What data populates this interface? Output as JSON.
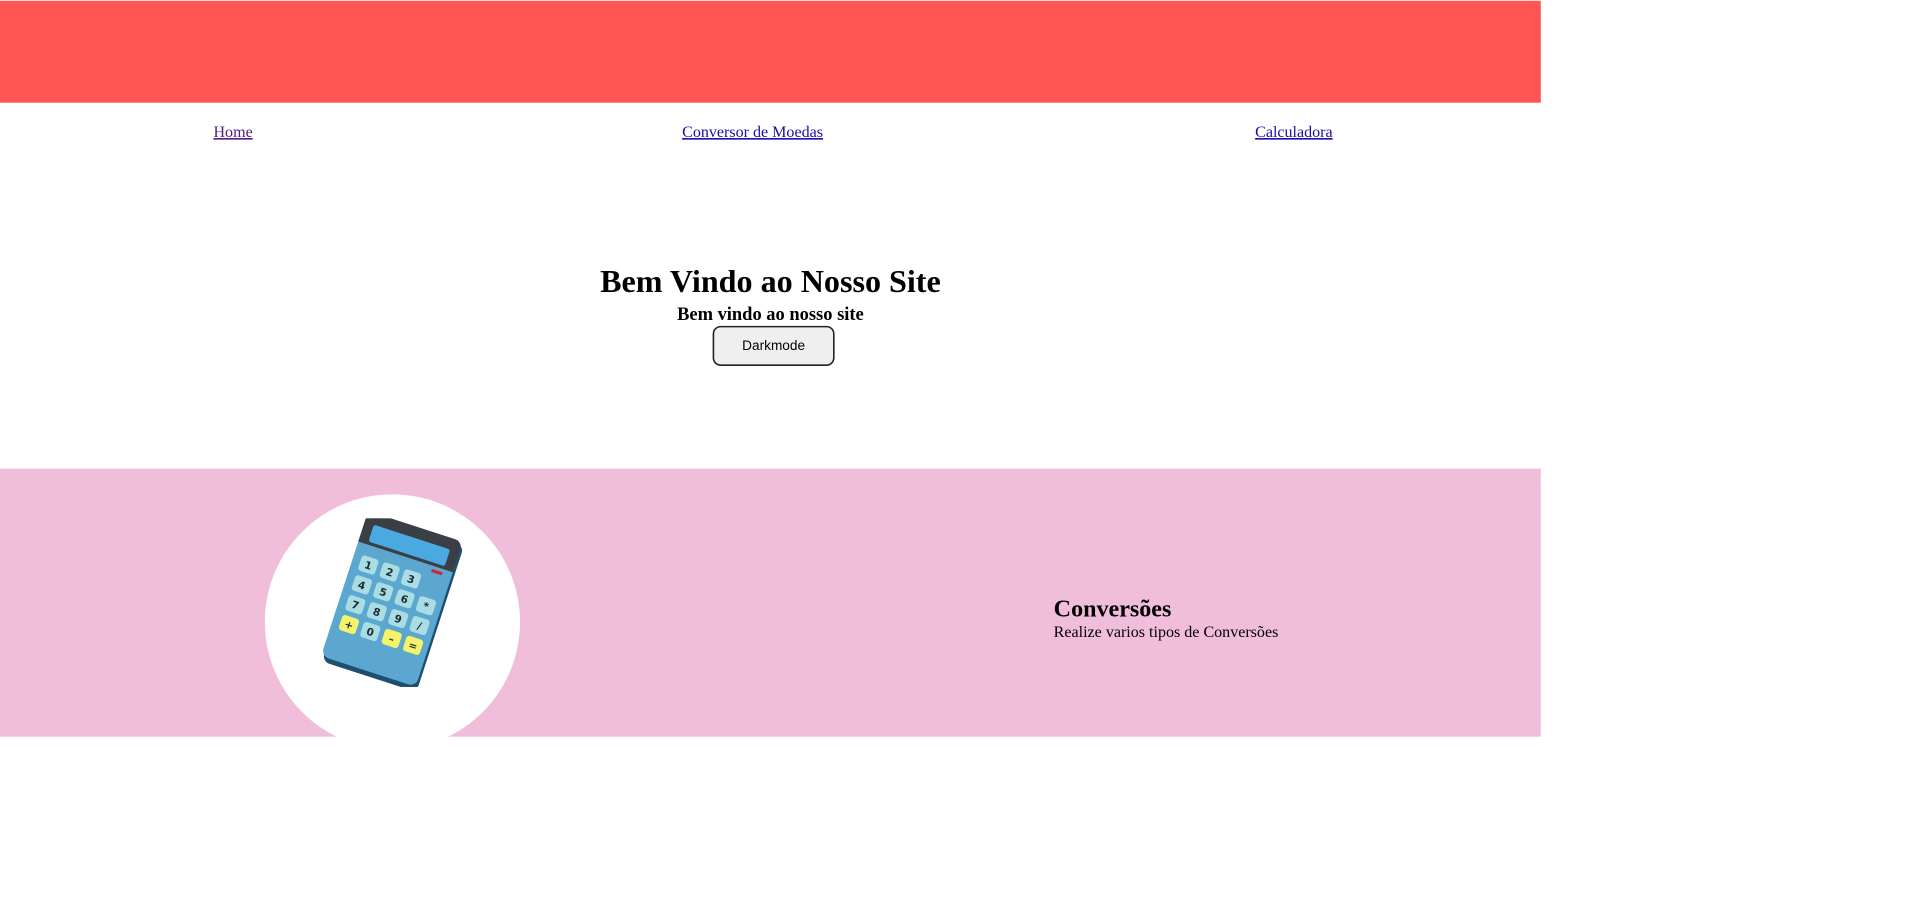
{
  "colors": {
    "banner": "#ff5555",
    "feature_bg": "#f0bedb",
    "link": "#1a0dab",
    "link_visited": "#551a8b"
  },
  "nav": {
    "items": [
      {
        "label": "Home"
      },
      {
        "label": "Conversor de Moedas"
      },
      {
        "label": "Calculadora"
      }
    ]
  },
  "hero": {
    "title": "Bem Vindo ao Nosso Site",
    "subtitle": "Bem vindo ao nosso site",
    "darkmode_label": "Darkmode"
  },
  "feature": {
    "icon": "calculator-icon",
    "title": "Conversões",
    "description": "Realize varios tipos de Conversões"
  }
}
